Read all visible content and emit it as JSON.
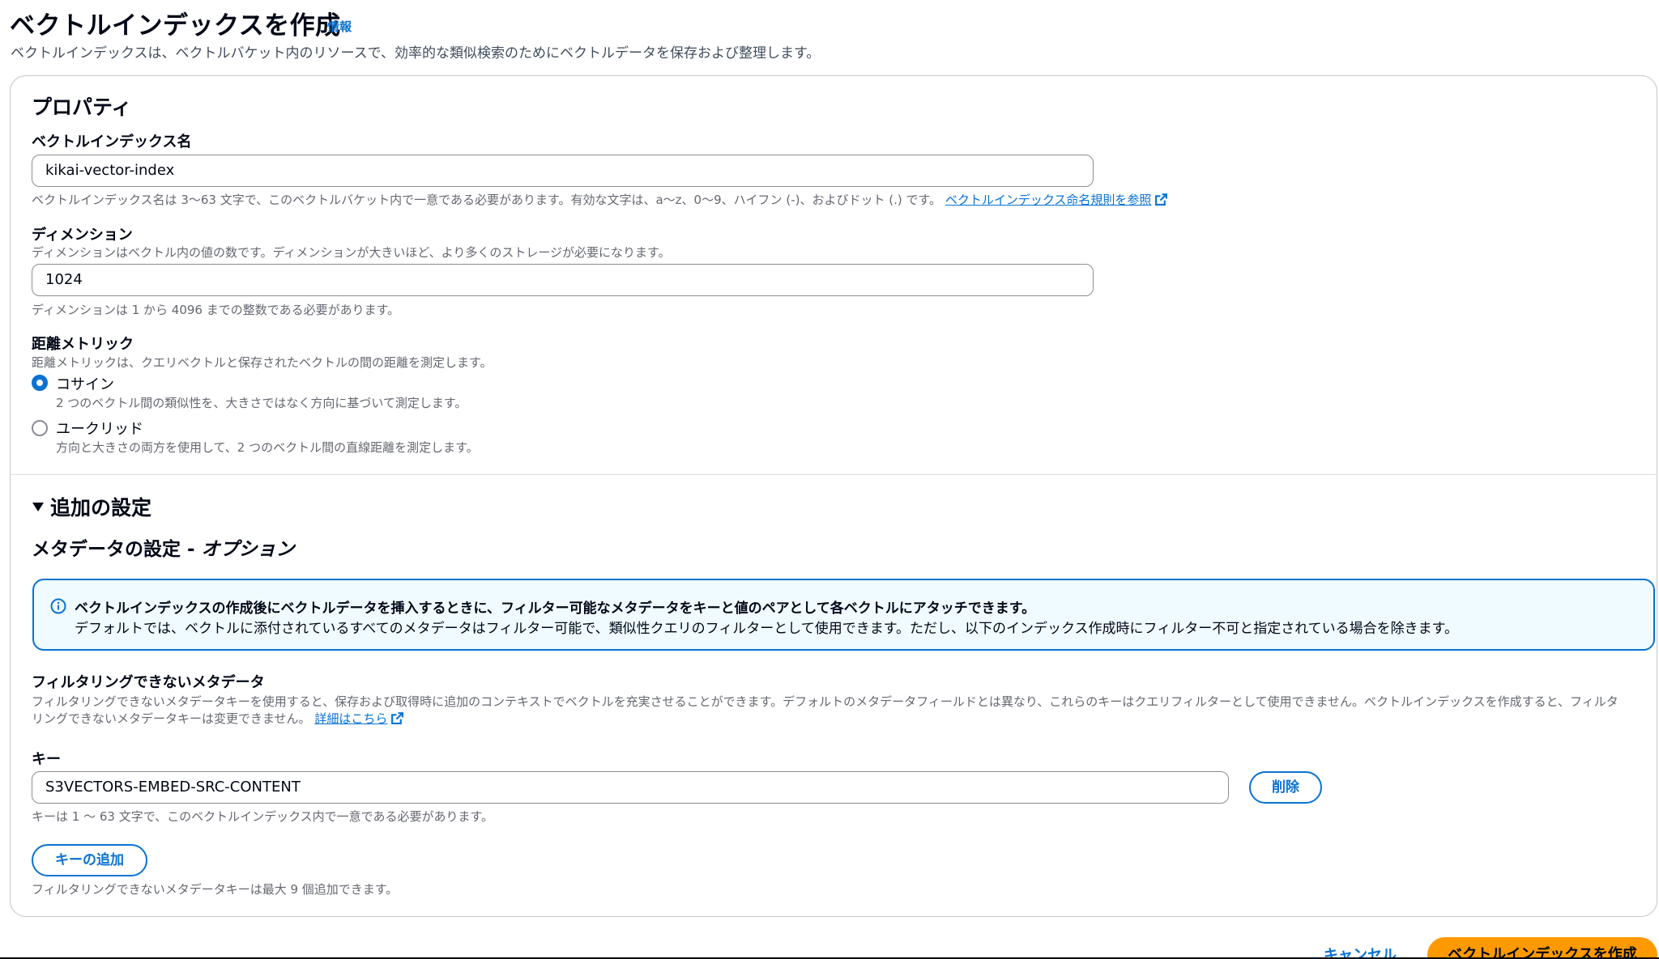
{
  "header": {
    "title": "ベクトルインデックスを作成",
    "info_link": "情報",
    "description": "ベクトルインデックスは、ベクトルバケット内のリソースで、効率的な類似検索のためにベクトルデータを保存および整理します。"
  },
  "properties": {
    "section_title": "プロパティ",
    "index_name": {
      "label": "ベクトルインデックス名",
      "value": "kikai-vector-index",
      "hint": "ベクトルインデックス名は 3〜63 文字で、このベクトルバケット内で一意である必要があります。有効な文字は、a〜z、0〜9、ハイフン (-)、およびドット (.) です。",
      "hint_link": "ベクトルインデックス命名規則を参照"
    },
    "dimension": {
      "label": "ディメンション",
      "description": "ディメンションはベクトル内の値の数です。ディメンションが大きいほど、より多くのストレージが必要になります。",
      "value": "1024",
      "hint": "ディメンションは 1 から 4096 までの整数である必要があります。"
    },
    "distance_metric": {
      "label": "距離メトリック",
      "description": "距離メトリックは、クエリベクトルと保存されたベクトルの間の距離を測定します。",
      "options": [
        {
          "label": "コサイン",
          "description": "2 つのベクトル間の類似性を、大きさではなく方向に基づいて測定します。",
          "selected": true
        },
        {
          "label": "ユークリッド",
          "description": "方向と大きさの両方を使用して、2 つのベクトル間の直線距離を測定します。",
          "selected": false
        }
      ]
    }
  },
  "additional": {
    "expander_label": "追加の設定",
    "metadata_title": "メタデータの設定 - ",
    "metadata_title_optional": "オプション",
    "alert": {
      "title": "ベクトルインデックスの作成後にベクトルデータを挿入するときに、フィルター可能なメタデータをキーと値のペアとして各ベクトルにアタッチできます。",
      "body": "デフォルトでは、ベクトルに添付されているすべてのメタデータはフィルター可能で、類似性クエリのフィルターとして使用できます。ただし、以下のインデックス作成時にフィルター不可と指定されている場合を除きます。"
    },
    "non_filterable": {
      "label": "フィルタリングできないメタデータ",
      "description_line1": "フィルタリングできないメタデータキーを使用すると、保存および取得時に追加のコンテキストでベクトルを充実させることができます。デフォルトのメタデータフィールドとは異なり、これらのキーはクエリフィルターとして使用できません。ベクトルインデックスを作成すると、フィルタ",
      "description_line2": "リングできないメタデータキーは変更できません。",
      "learn_more": "詳細はこちら"
    },
    "key": {
      "label": "キー",
      "value": "S3VECTORS-EMBED-SRC-CONTENT",
      "hint": "キーは 1 〜 63 文字で、このベクトルインデックス内で一意である必要があります。",
      "remove_button": "削除"
    },
    "add_key_button": "キーの追加",
    "add_key_hint": "フィルタリングできないメタデータキーは最大 9 個追加できます。"
  },
  "footer": {
    "cancel_button": "キャンセル",
    "create_button": "ベクトルインデックスを作成"
  },
  "colors": {
    "primary_blue": "#0972d3",
    "primary_action": "#ff9900",
    "alert_bg": "#f0fbff"
  }
}
